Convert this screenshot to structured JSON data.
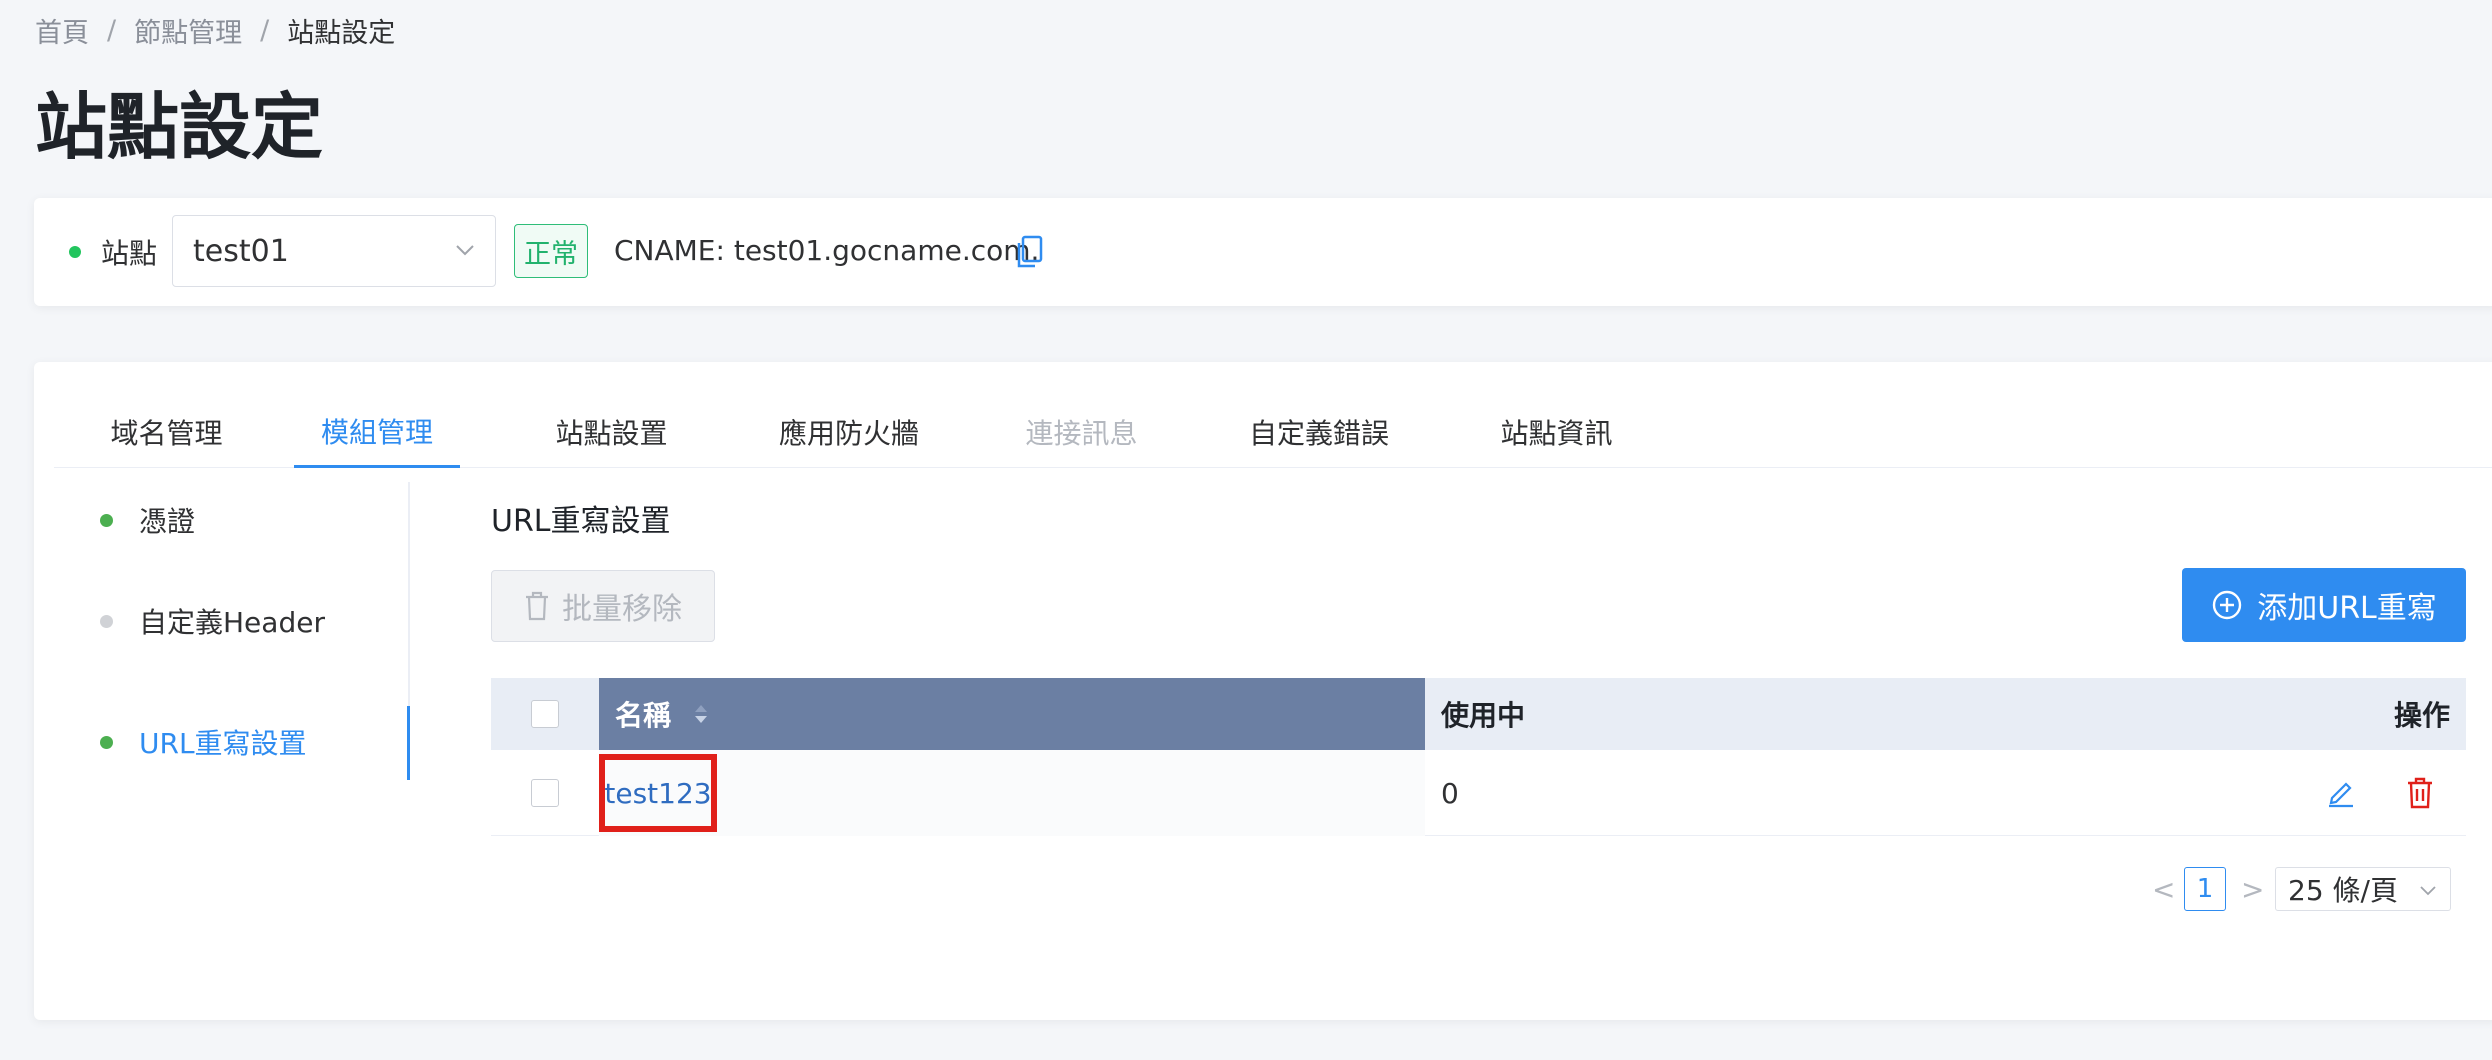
{
  "breadcrumb": {
    "home": "首頁",
    "sep": "/",
    "node_mgmt": "節點管理",
    "current": "站點設定"
  },
  "page_title": "站點設定",
  "site_bar": {
    "label": "站點",
    "selected_site": "test01",
    "status": "正常",
    "cname": "CNAME: test01.gocname.com.",
    "status_color": "#22b26d"
  },
  "tabs": [
    {
      "label": "域名管理"
    },
    {
      "label": "模組管理"
    },
    {
      "label": "站點設置"
    },
    {
      "label": "應用防火牆"
    },
    {
      "label": "連接訊息"
    },
    {
      "label": "自定義錯誤"
    },
    {
      "label": "站點資訊"
    }
  ],
  "subnav": [
    {
      "label": "憑證"
    },
    {
      "label": "自定義Header"
    },
    {
      "label": "URL重寫設置"
    }
  ],
  "section": {
    "title": "URL重寫設置",
    "bulk_remove": "批量移除",
    "add_button": "添加URL重寫"
  },
  "table": {
    "headers": {
      "name": "名稱",
      "in_use": "使用中",
      "actions": "操作"
    },
    "rows": [
      {
        "name": "test123",
        "in_use": "0"
      }
    ]
  },
  "pagination": {
    "prev": "<",
    "current_page": "1",
    "next": ">",
    "page_size": "25 條/頁"
  },
  "colors": {
    "primary": "#2f8cf0",
    "danger": "#e0201a",
    "header_highlight": "#6b7fa3"
  }
}
